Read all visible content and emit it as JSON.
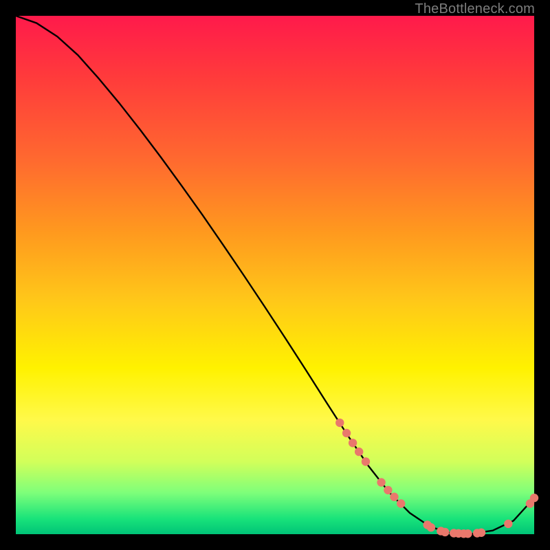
{
  "attribution": "TheBottleneck.com",
  "colors": {
    "background": "#000000",
    "gradient_top": "#ff1a4b",
    "gradient_bottom": "#00c477",
    "curve_stroke": "#000000",
    "marker_fill": "#e9786c",
    "marker_stroke": "#b24f46",
    "attribution_text": "#7d7d7d"
  },
  "chart_data": {
    "type": "line",
    "title": "",
    "xlabel": "",
    "ylabel": "",
    "xlim": [
      0,
      100
    ],
    "ylim": [
      0,
      100
    ],
    "series": [
      {
        "name": "bottleneck-curve",
        "x": [
          0,
          4,
          8,
          12,
          16,
          20,
          24,
          28,
          32,
          36,
          40,
          44,
          48,
          52,
          56,
          60,
          64,
          68,
          72,
          76,
          80,
          84,
          88,
          92,
          96,
          100
        ],
        "y": [
          100,
          98.6,
          96.0,
          92.4,
          87.9,
          83.1,
          78.0,
          72.7,
          67.2,
          61.6,
          55.8,
          49.9,
          43.9,
          37.8,
          31.6,
          25.3,
          19.1,
          13.2,
          8.1,
          4.1,
          1.4,
          0.2,
          0.1,
          0.7,
          2.6,
          7.0
        ]
      }
    ],
    "markers": [
      {
        "x": 62.5,
        "y": 21.5
      },
      {
        "x": 63.8,
        "y": 19.5
      },
      {
        "x": 65.0,
        "y": 17.6
      },
      {
        "x": 66.2,
        "y": 15.9
      },
      {
        "x": 67.5,
        "y": 14.0
      },
      {
        "x": 70.5,
        "y": 10.0
      },
      {
        "x": 71.8,
        "y": 8.5
      },
      {
        "x": 73.0,
        "y": 7.2
      },
      {
        "x": 74.3,
        "y": 5.9
      },
      {
        "x": 79.4,
        "y": 1.8
      },
      {
        "x": 80.1,
        "y": 1.3
      },
      {
        "x": 82.0,
        "y": 0.6
      },
      {
        "x": 82.8,
        "y": 0.4
      },
      {
        "x": 84.5,
        "y": 0.2
      },
      {
        "x": 85.4,
        "y": 0.15
      },
      {
        "x": 86.4,
        "y": 0.1
      },
      {
        "x": 87.2,
        "y": 0.1
      },
      {
        "x": 89.0,
        "y": 0.2
      },
      {
        "x": 89.8,
        "y": 0.3
      },
      {
        "x": 95.0,
        "y": 2.0
      },
      {
        "x": 99.2,
        "y": 5.9
      },
      {
        "x": 100.0,
        "y": 7.0
      }
    ]
  }
}
